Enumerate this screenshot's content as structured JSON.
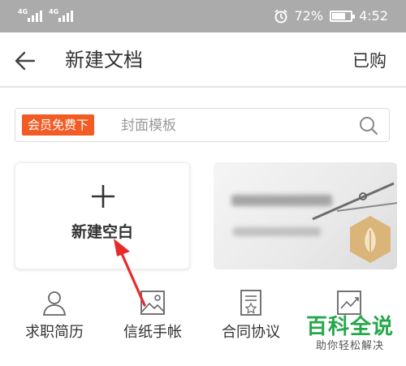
{
  "status_bar": {
    "signal_1_tag": "4G",
    "signal_2_tag": "4G",
    "battery": "72%",
    "battery_level": 0.72,
    "time": "4:52"
  },
  "header": {
    "title": "新建文档",
    "purchased_label": "已购"
  },
  "search": {
    "tag": "会员免费下",
    "placeholder": "封面模板"
  },
  "cards": {
    "new_blank_label": "新建空白"
  },
  "categories": [
    {
      "label": "求职简历",
      "icon": "person-icon"
    },
    {
      "label": "信纸手帐",
      "icon": "image-icon"
    },
    {
      "label": "合同协议",
      "icon": "document-icon"
    },
    {
      "label": "",
      "icon": "chart-icon"
    }
  ],
  "watermark": {
    "title": "百科全说",
    "subtitle": "助你轻松解决"
  },
  "colors": {
    "status_bar_bg": "#ababab",
    "vip_tag_bg": "#f35b24",
    "arrow_red": "#e82a2a",
    "watermark_green": "#25a74b",
    "badge_gold": "#d9b57a"
  }
}
